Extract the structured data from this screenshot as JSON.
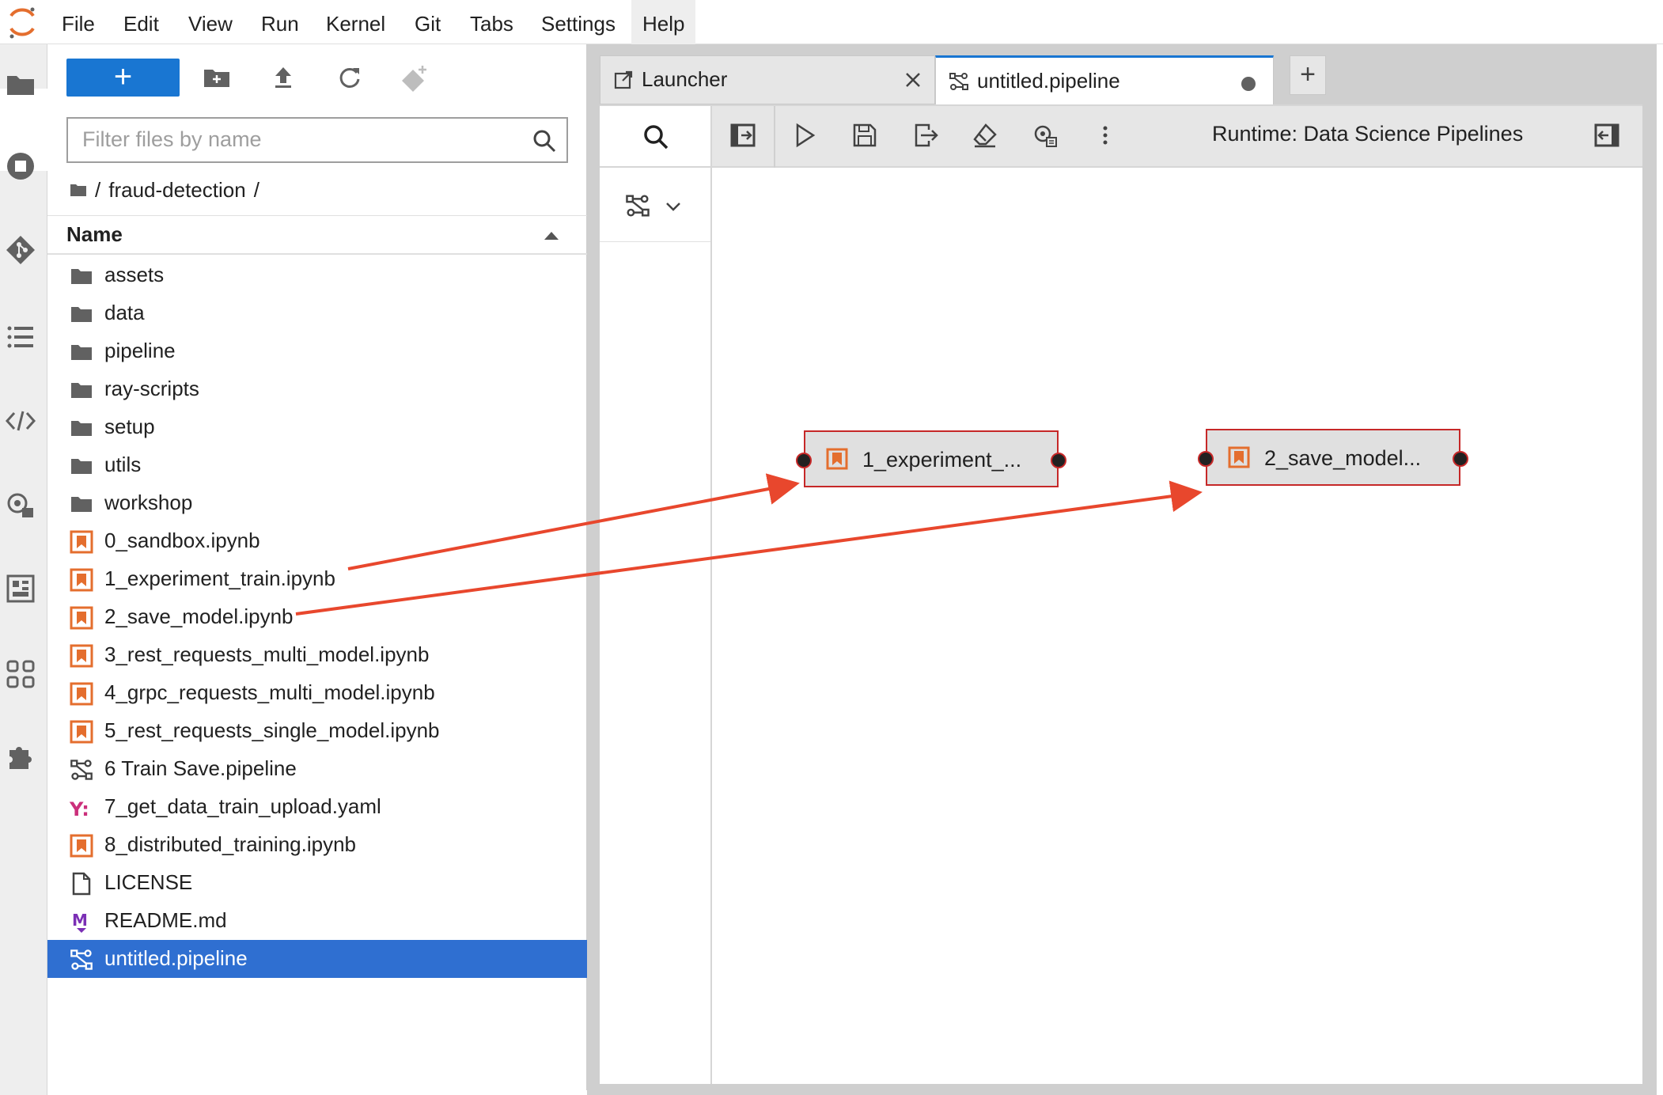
{
  "menu": [
    "File",
    "Edit",
    "View",
    "Run",
    "Kernel",
    "Git",
    "Tabs",
    "Settings",
    "Help"
  ],
  "filebrowser": {
    "new_label": "+",
    "filter_placeholder": "Filter files by name",
    "breadcrumb_root": "/",
    "breadcrumb_folder": "fraud-detection",
    "breadcrumb_trailing": "/",
    "column_name": "Name",
    "files": [
      {
        "name": "assets",
        "type": "folder"
      },
      {
        "name": "data",
        "type": "folder"
      },
      {
        "name": "pipeline",
        "type": "folder"
      },
      {
        "name": "ray-scripts",
        "type": "folder"
      },
      {
        "name": "setup",
        "type": "folder"
      },
      {
        "name": "utils",
        "type": "folder"
      },
      {
        "name": "workshop",
        "type": "folder"
      },
      {
        "name": "0_sandbox.ipynb",
        "type": "notebook"
      },
      {
        "name": "1_experiment_train.ipynb",
        "type": "notebook"
      },
      {
        "name": "2_save_model.ipynb",
        "type": "notebook"
      },
      {
        "name": "3_rest_requests_multi_model.ipynb",
        "type": "notebook"
      },
      {
        "name": "4_grpc_requests_multi_model.ipynb",
        "type": "notebook"
      },
      {
        "name": "5_rest_requests_single_model.ipynb",
        "type": "notebook"
      },
      {
        "name": "6 Train Save.pipeline",
        "type": "pipeline"
      },
      {
        "name": "7_get_data_train_upload.yaml",
        "type": "yaml"
      },
      {
        "name": "8_distributed_training.ipynb",
        "type": "notebook"
      },
      {
        "name": "LICENSE",
        "type": "file"
      },
      {
        "name": "README.md",
        "type": "markdown"
      },
      {
        "name": "untitled.pipeline",
        "type": "pipeline",
        "selected": true
      }
    ]
  },
  "tabs": [
    {
      "label": "Launcher",
      "icon": "launcher-icon"
    },
    {
      "label": "untitled.pipeline",
      "icon": "pipeline-icon",
      "active": true,
      "modified": true
    }
  ],
  "add_tab_label": "+",
  "pipeline_editor": {
    "runtime_label": "Runtime: Data Science Pipelines",
    "nodes": [
      {
        "label": "1_experiment_..."
      },
      {
        "label": "2_save_model..."
      }
    ]
  },
  "colors": {
    "accent": "#1976d2",
    "selection": "#2f6fd1",
    "notebook_orange": "#e46e2e",
    "annotation_red": "#e8472d",
    "yaml_magenta": "#cb2f7b",
    "markdown_purple": "#7b2fb5"
  }
}
